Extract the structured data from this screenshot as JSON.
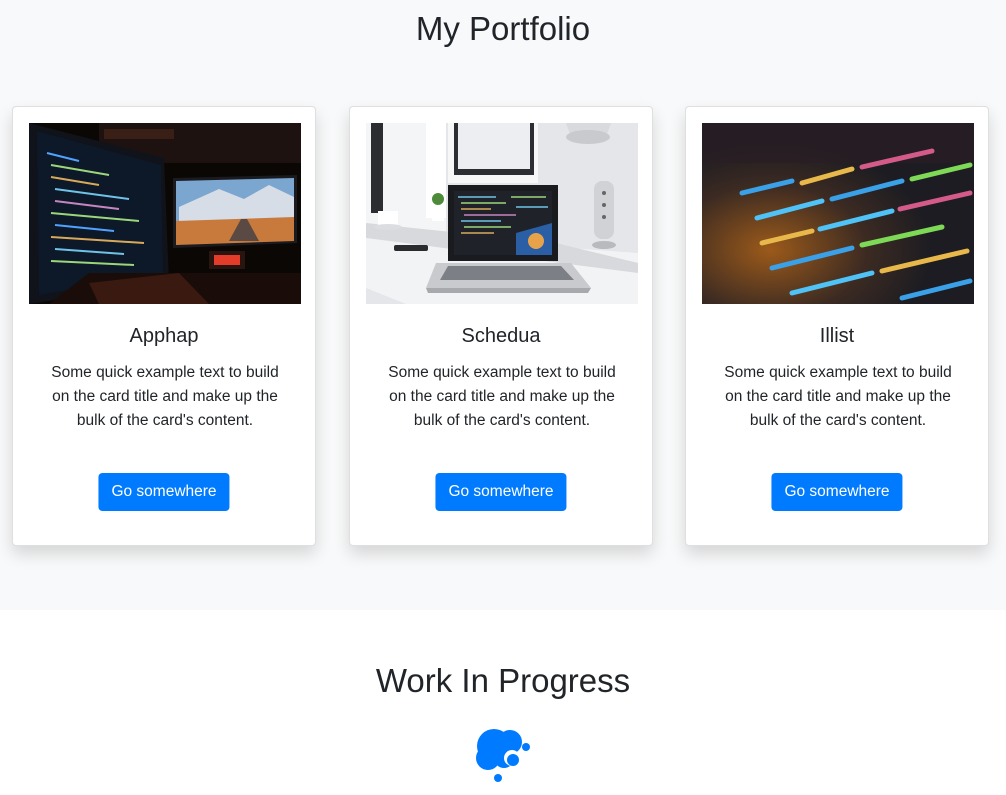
{
  "portfolio": {
    "title": "My Portfolio",
    "cards": [
      {
        "title": "Apphap",
        "text": "Some quick example text to build on the card title and make up the bulk of the card's content.",
        "button": "Go somewhere",
        "image_icon": "dual-monitor-code-photo"
      },
      {
        "title": "Schedua",
        "text": "Some quick example text to build on the card title and make up the bulk of the card's content.",
        "button": "Go somewhere",
        "image_icon": "laptop-desk-photo"
      },
      {
        "title": "Illist",
        "text": "Some quick example text to build on the card title and make up the bulk of the card's content.",
        "button": "Go somewhere",
        "image_icon": "colorful-code-photo"
      }
    ]
  },
  "wip": {
    "title": "Work In Progress",
    "icon": "blue-bubbles-logo"
  },
  "colors": {
    "primary": "#007bff",
    "section_bg": "#f8f9fa",
    "text": "#212529"
  }
}
